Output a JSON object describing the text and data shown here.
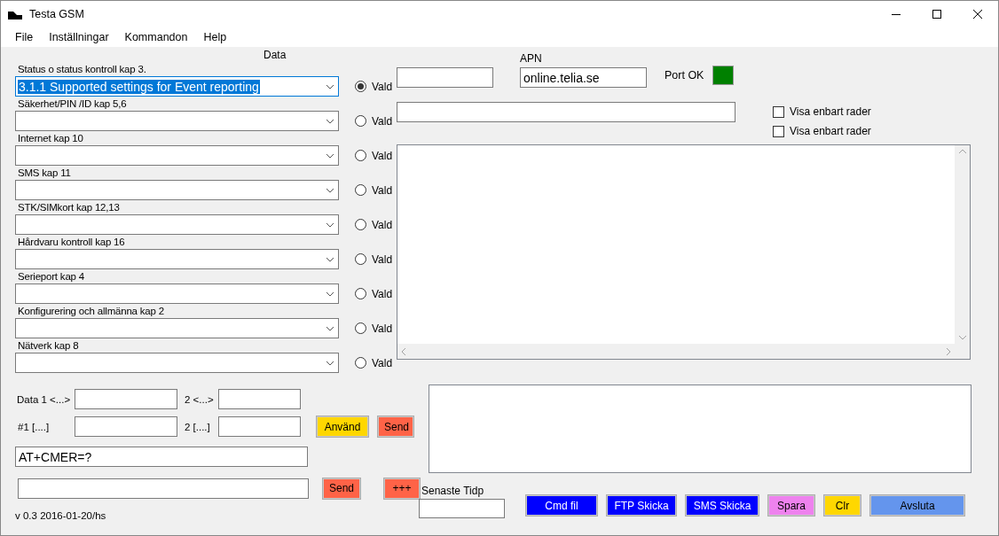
{
  "window": {
    "title": "Testa GSM"
  },
  "menu": [
    "File",
    "Inställningar",
    "Kommandon",
    "Help"
  ],
  "data_heading": "Data",
  "groups": [
    {
      "label": "Status o status kontroll kap 3.",
      "value": "3.1.1 Supported settings for Event reporting",
      "focused": true,
      "radio_label": "Vald",
      "selected": true
    },
    {
      "label": "Säkerhet/PIN /ID kap 5,6",
      "focused": false,
      "radio_label": "Vald",
      "selected": false
    },
    {
      "label": "Internet kap 10",
      "focused": false,
      "radio_label": "Vald",
      "selected": false
    },
    {
      "label": "SMS kap 11",
      "focused": false,
      "radio_label": "Vald",
      "selected": false
    },
    {
      "label": "STK/SIMkort kap 12,13",
      "focused": false,
      "radio_label": "Vald",
      "selected": false
    },
    {
      "label": "Hårdvaru kontroll  kap 16",
      "focused": false,
      "radio_label": "Vald",
      "selected": false
    },
    {
      "label": "Serieport kap 4",
      "focused": false,
      "radio_label": "Vald",
      "selected": false
    },
    {
      "label": "Konfigurering och allmänna kap 2",
      "focused": false,
      "radio_label": "Vald",
      "selected": false
    },
    {
      "label": "Nätverk kap 8",
      "focused": false,
      "radio_label": "Vald",
      "selected": false
    }
  ],
  "params": {
    "data1_label": "Data 1 <...>",
    "data2_label": "2 <...>",
    "hash1_label": "#1  [....]",
    "hash2_label": "2  [....]"
  },
  "param_buttons": [
    {
      "label": "Använd",
      "color": "#ffd700"
    },
    {
      "label": "Send",
      "color": "#ff6347"
    }
  ],
  "command": {
    "value": "AT+CMER=?"
  },
  "send_row_buttons": [
    {
      "label": "Send",
      "color": "#ff6347"
    },
    {
      "label": "+++",
      "color": "#ff6347"
    }
  ],
  "version": "v 0.3 2016-01-20/hs",
  "apn": {
    "label": "APN",
    "value": "online.telia.se"
  },
  "port": {
    "label": "Port OK",
    "color": "#008000"
  },
  "checkboxes": [
    {
      "label": "Visa enbart rader",
      "checked": false
    },
    {
      "label": "Visa enbart rader",
      "checked": false
    }
  ],
  "last_time": {
    "label": "Senaste Tidp"
  },
  "bottom_buttons": [
    {
      "label": "Cmd fil",
      "color": "#0000ff"
    },
    {
      "label": "FTP Skicka",
      "color": "#0000ff"
    },
    {
      "label": "SMS Skicka",
      "color": "#0000ff"
    },
    {
      "label": "Spara",
      "color": "#ee82ee"
    },
    {
      "label": "Clr",
      "color": "#ffd700"
    },
    {
      "label": "Avsluta",
      "color": "#6495ed"
    }
  ]
}
